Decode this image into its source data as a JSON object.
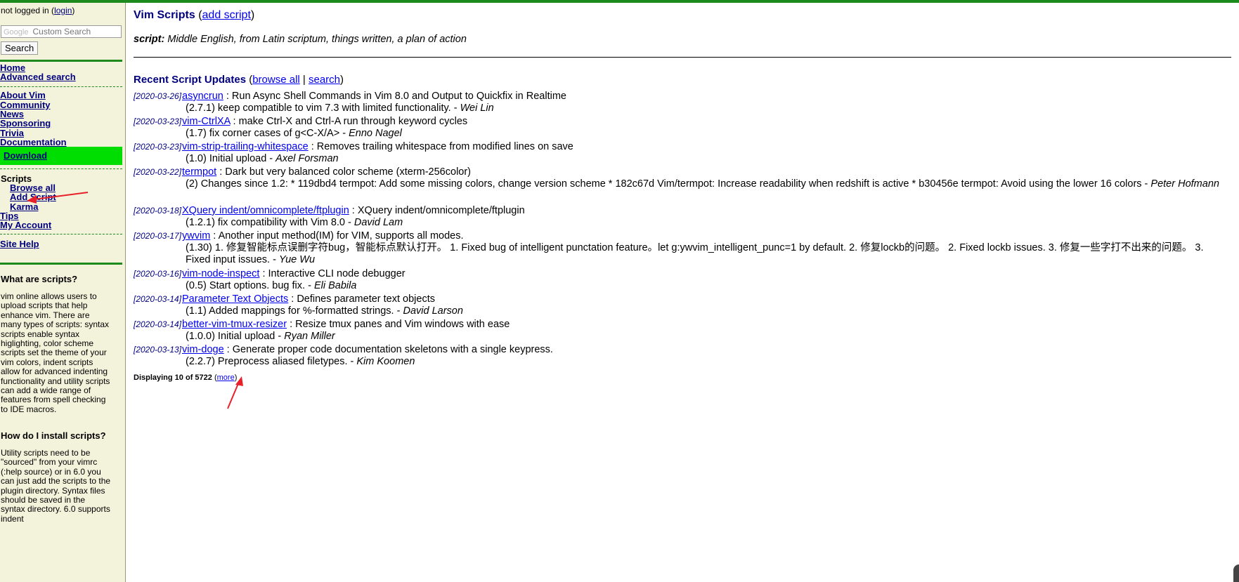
{
  "sidebar": {
    "login_prefix": "not logged in (",
    "login_link": "login",
    "login_suffix": ")",
    "search_brand": "Google",
    "search_placeholder": "Custom Search",
    "search_button": "Search",
    "nav_primary": [
      "Home",
      "Advanced search"
    ],
    "nav_secondary": [
      "About Vim",
      "Community",
      "News",
      "Sponsoring",
      "Trivia",
      "Documentation"
    ],
    "download": "Download",
    "current_section": "Scripts",
    "scripts_sub": [
      "Browse all",
      "Add Script",
      "Karma"
    ],
    "nav_tertiary": [
      "Tips",
      "My Account"
    ],
    "site_help": "Site Help",
    "faq": [
      {
        "question": "What are scripts?",
        "answer": "vim online allows users to upload scripts that help enhance vim. There are many types of scripts: syntax scripts enable syntax higlighting, color scheme scripts set the theme of your vim colors, indent scripts allow for advanced indenting functionality and utility scripts can add a wide range of features from spell checking to IDE macros."
      },
      {
        "question": "How do I install scripts?",
        "answer": "Utility scripts need to be \"sourced\" from your vimrc (:help source) or in 6.0 you can just add the scripts to the plugin directory. Syntax files should be saved in the syntax directory. 6.0 supports indent"
      }
    ]
  },
  "main": {
    "title": "Vim Scripts",
    "title_link": "add script",
    "definition_term": "script:",
    "definition_text": "Middle English, from Latin scriptum, things written, a plan of action",
    "recent_heading": "Recent Script Updates",
    "browse_all": "browse all",
    "search": "search",
    "updates": [
      {
        "date": "[2020-03-26]",
        "name": "asyncrun",
        "desc": " : Run Async Shell Commands in Vim 8.0 and Output to Quickfix in Realtime",
        "detail": "(2.7.1) keep compatible to vim 7.3 with limited functionality. - ",
        "author": "Wei Lin"
      },
      {
        "date": "[2020-03-23]",
        "name": "vim-CtrlXA",
        "desc": " : make Ctrl-X and Ctrl-A run through keyword cycles",
        "detail": "(1.7) fix corner cases of g<C-X/A> - ",
        "author": "Enno Nagel"
      },
      {
        "date": "[2020-03-23]",
        "name": "vim-strip-trailing-whitespace",
        "desc": " : Removes trailing whitespace from modified lines on save",
        "detail": "(1.0) Initial upload - ",
        "author": "Axel Forsman"
      },
      {
        "date": "[2020-03-22]",
        "name": "termpot",
        "desc": " : Dark but very balanced color scheme (xterm-256color)",
        "detail": "(2) Changes since 1.2: * 119dbd4 termpot: Add some missing colors, change version scheme * 182c67d Vim/termpot: Increase readability when redshift is active * b30456e termpot: Avoid using the lower 16 colors - ",
        "author": "Peter Hofmann"
      },
      {
        "date": "[2020-03-18]",
        "name": "XQuery indent/omnicomplete/ftplugin",
        "desc": " : XQuery indent/omnicomplete/ftplugin",
        "detail": "(1.2.1) fix compatibility with Vim 8.0 - ",
        "author": "David Lam"
      },
      {
        "date": "[2020-03-17]",
        "name": "ywvim",
        "desc": " : Another input method(IM) for VIM, supports all modes.",
        "detail": "(1.30) 1. 修复智能标点误删字符bug，智能标点默认打开。 1. Fixed bug of intelligent punctation feature。let g:ywvim_intelligent_punc=1 by default. 2. 修复lockb的问题。 2. Fixed lockb issues. 3. 修复一些字打不出来的问题。 3. Fixed input issues. - ",
        "author": "Yue Wu"
      },
      {
        "date": "[2020-03-16]",
        "name": "vim-node-inspect",
        "desc": " : Interactive CLI node debugger",
        "detail": "(0.5) Start options. bug fix. - ",
        "author": "Eli Babila"
      },
      {
        "date": "[2020-03-14]",
        "name": "Parameter Text Objects",
        "desc": " : Defines parameter text objects",
        "detail": "(1.1) Added mappings for %-formatted strings. - ",
        "author": "David Larson"
      },
      {
        "date": "[2020-03-14]",
        "name": "better-vim-tmux-resizer",
        "desc": " : Resize tmux panes and Vim windows with ease",
        "detail": "(1.0.0) Initial upload - ",
        "author": "Ryan Miller"
      },
      {
        "date": "[2020-03-13]",
        "name": "vim-doge",
        "desc": " : Generate proper code documentation skeletons with a single keypress.",
        "detail": "(2.2.7) Preprocess aliased filetypes. - ",
        "author": "Kim Koomen"
      }
    ],
    "footer_text": "Displaying 10 of 5722",
    "more_link": "more"
  },
  "colors": {
    "accent_green": "#1c8a1c",
    "download_green": "#00dd00",
    "sidebar_bg": "#f3f3dc",
    "link_blue": "#0000ee",
    "navy": "#000080",
    "annotation_red": "#e8202a"
  }
}
